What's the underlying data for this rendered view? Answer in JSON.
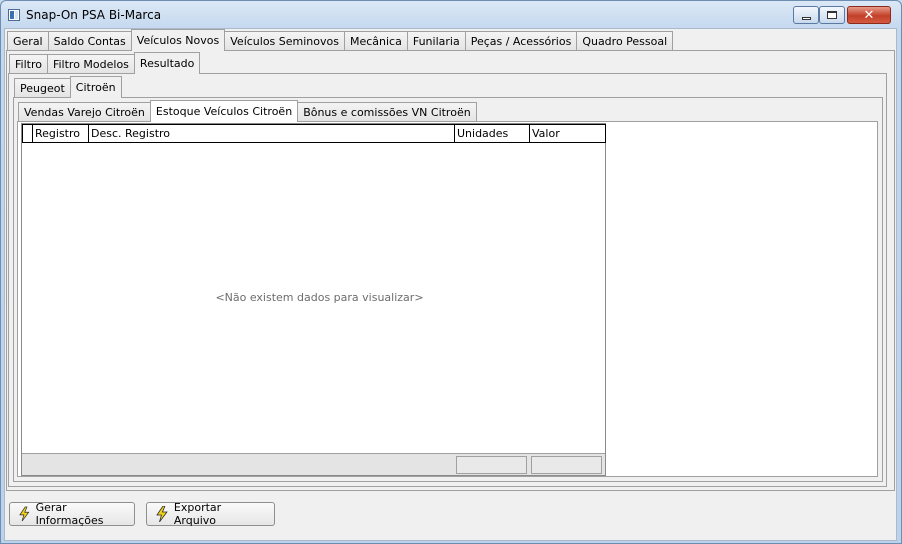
{
  "window": {
    "title": "Snap-On PSA Bi-Marca"
  },
  "main_tabs": [
    "Geral",
    "Saldo Contas",
    "Veículos Novos",
    "Veículos Seminovos",
    "Mecânica",
    "Funilaria",
    "Peças / Acessórios",
    "Quadro Pessoal"
  ],
  "sub_tabs": [
    "Filtro",
    "Filtro Modelos",
    "Resultado"
  ],
  "brand_tabs": [
    "Peugeot",
    "Citroën"
  ],
  "report_tabs": [
    "Vendas Varejo Citroën",
    "Estoque Veículos Citroën",
    "Bônus e comissões VN Citroën"
  ],
  "grid": {
    "columns": [
      "Registro",
      "Desc. Registro",
      "Unidades",
      "Valor"
    ],
    "empty_message": "<Não existem dados para visualizar>"
  },
  "buttons": {
    "gerar": "Gerar Informações",
    "exportar": "Exportar Arquivo"
  },
  "colors": {
    "bolt": "#f2d21a"
  }
}
